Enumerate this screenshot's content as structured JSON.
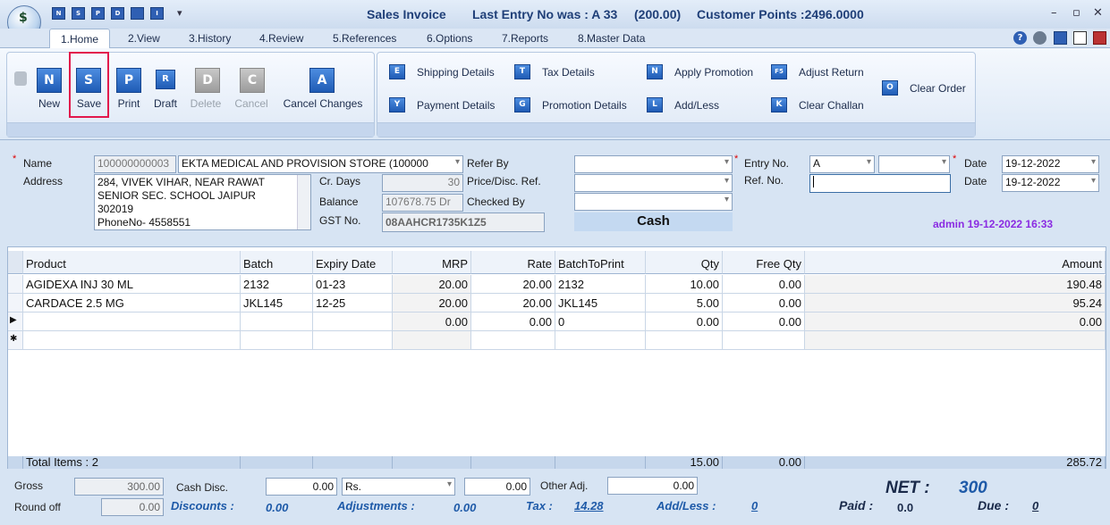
{
  "window": {
    "title": "Sales Invoice",
    "last_entry": "Last Entry No was : A 33",
    "amount": "(200.00)",
    "customer_points": "Customer Points :2496.0000",
    "minimize": "–",
    "restore": "▫",
    "close": "✕"
  },
  "quick_access": [
    "N",
    "S",
    "P",
    "D",
    "",
    "I"
  ],
  "tabs": [
    "1.Home",
    "2.View",
    "3.History",
    "4.Review",
    "5.References",
    "6.Options",
    "7.Reports",
    "8.Master Data"
  ],
  "ribbon": {
    "buttons": [
      {
        "icon": "N",
        "label": "New"
      },
      {
        "icon": "S",
        "label": "Save"
      },
      {
        "icon": "P",
        "label": "Print"
      },
      {
        "icon": "R",
        "label": "Draft"
      },
      {
        "icon": "D",
        "label": "Delete"
      },
      {
        "icon": "C",
        "label": "Cancel"
      },
      {
        "icon": "A",
        "label": "Cancel Changes"
      }
    ],
    "actions": [
      {
        "icon": "E",
        "label": "Shipping Details"
      },
      {
        "icon": "T",
        "label": "Tax Details"
      },
      {
        "icon": "N",
        "label": "Apply Promotion"
      },
      {
        "icon": "F5",
        "label": "Adjust Return"
      },
      {
        "icon": "Y",
        "label": "Payment Details"
      },
      {
        "icon": "G",
        "label": "Promotion Details"
      },
      {
        "icon": "L",
        "label": "Add/Less"
      },
      {
        "icon": "K",
        "label": "Clear Challan"
      },
      {
        "icon": "O",
        "label": "Clear Order"
      }
    ]
  },
  "header": {
    "name_label": "Name",
    "name_code": "100000000003",
    "name_value": "EKTA MEDICAL AND PROVISION STORE (100000",
    "address_label": "Address",
    "address_lines": [
      "284, VIVEK VIHAR, NEAR RAWAT",
      "SENIOR  SEC. SCHOOL JAIPUR",
      "302019",
      "PhoneNo- 4558551"
    ],
    "cr_days_label": "Cr. Days",
    "cr_days": "30",
    "balance_label": "Balance",
    "balance": "107678.75 Dr",
    "gst_label": "GST No.",
    "gst": "08AAHCR1735K1Z5",
    "refer_by_label": "Refer By",
    "price_disc_label": "Price/Disc. Ref.",
    "checked_by_label": "Checked By",
    "cash_label": "Cash",
    "entry_no_label": "Entry No.",
    "entry_series": "A",
    "ref_no_label": "Ref. No.",
    "date_label": "Date",
    "date1": "19-12-2022",
    "date2": "19-12-2022",
    "user_stamp": "admin 19-12-2022 16:33"
  },
  "grid": {
    "columns": [
      "Product",
      "Batch",
      "Expiry Date",
      "MRP",
      "Rate",
      "BatchToPrint",
      "Qty",
      "Free Qty",
      "Amount"
    ],
    "rows": [
      [
        "AGIDEXA INJ 30 ML",
        "2132",
        "01-23",
        "20.00",
        "20.00",
        "2132",
        "10.00",
        "0.00",
        "190.48"
      ],
      [
        "CARDACE 2.5 MG",
        "JKL145",
        "12-25",
        "20.00",
        "20.00",
        "JKL145",
        "5.00",
        "0.00",
        "95.24"
      ],
      [
        "",
        "",
        "",
        "0.00",
        "0.00",
        "0",
        "0.00",
        "0.00",
        "0.00"
      ],
      [
        "",
        "",
        "",
        "",
        "",
        "",
        "",
        "",
        ""
      ]
    ],
    "row_markers": [
      "",
      "",
      "▶",
      "✱"
    ],
    "total_label": "Total Items : 2",
    "total_qty": "15.00",
    "total_free": "0.00",
    "total_amount": "285.72"
  },
  "footer": {
    "gross_label": "Gross",
    "gross": "300.00",
    "cash_disc_label": "Cash Disc.",
    "cash_disc": "0.00",
    "currency": "Rs.",
    "cash_disc2": "0.00",
    "other_adj_label": "Other Adj.",
    "other_adj": "0.00",
    "round_off_label": "Round off",
    "round_off": "0.00",
    "discounts_label": "Discounts :",
    "discounts": "0.00",
    "adjustments_label": "Adjustments :",
    "adjustments": "0.00",
    "tax_label": "Tax :",
    "tax": "14.28",
    "addless_label": "Add/Less :",
    "addless": "0",
    "net_label": "NET :",
    "net": "300",
    "paid_label": "Paid :",
    "paid": "0.0",
    "due_label": "Due :",
    "due": "0"
  }
}
